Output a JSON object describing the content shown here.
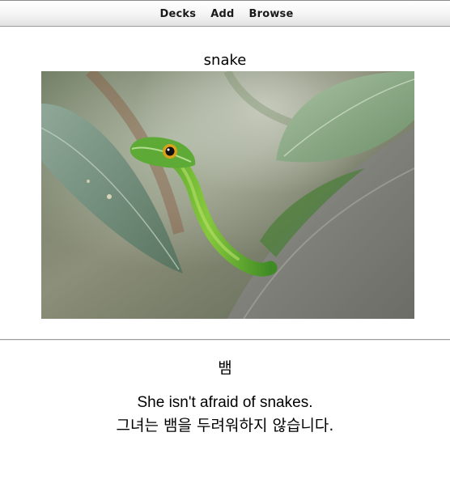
{
  "nav": {
    "decks": "Decks",
    "add": "Add",
    "browse": "Browse"
  },
  "card": {
    "front": {
      "word": "snake",
      "image_subject": "green snake among leaves on a rock"
    },
    "back": {
      "translation": "뱀",
      "example_en": "She isn't afraid of snakes.",
      "example_ko": "그녀는 뱀을 두려워하지 않습니다."
    }
  },
  "colors": {
    "toolbar_top": "#ffffff",
    "toolbar_bottom": "#e2e2e2",
    "divider": "#9c9c9c",
    "text": "#000000"
  }
}
